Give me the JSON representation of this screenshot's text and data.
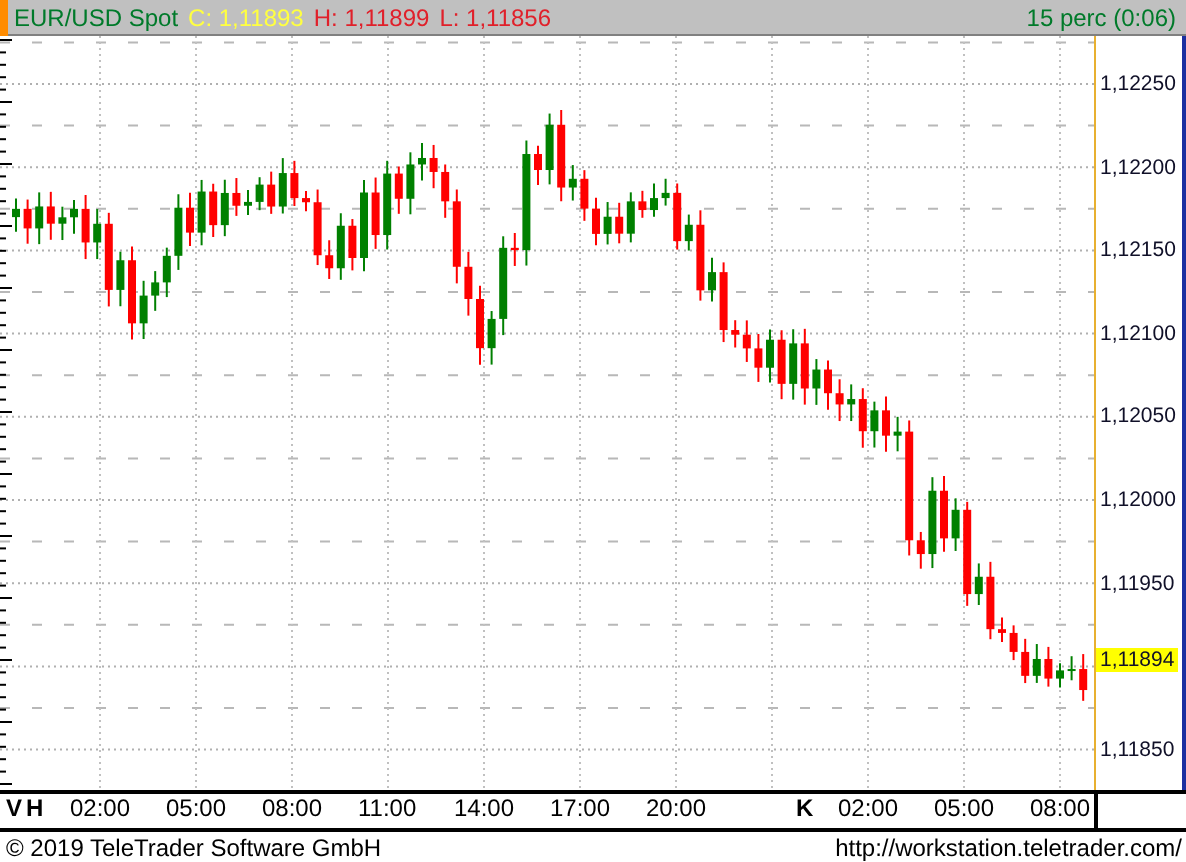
{
  "header": {
    "symbol": "EUR/USD Spot",
    "close": "C: 1,11893",
    "high": "H: 1,11899",
    "low": "L: 1,11856",
    "interval": "15 perc (0:06)"
  },
  "y_axis": {
    "labels": [
      {
        "text": "1,12250",
        "kind": "tick"
      },
      {
        "text": "1,12200",
        "kind": "tick"
      },
      {
        "text": "1,12150",
        "kind": "tick"
      },
      {
        "text": "1,12100",
        "kind": "tick"
      },
      {
        "text": "1,12050",
        "kind": "tick"
      },
      {
        "text": "1,12000",
        "kind": "tick"
      },
      {
        "text": "1,11950",
        "kind": "tick"
      },
      {
        "text": "1,11894",
        "kind": "current"
      },
      {
        "text": "1,11850",
        "kind": "tick"
      }
    ]
  },
  "x_axis": {
    "labels": [
      {
        "text": "V",
        "kind": "day"
      },
      {
        "text": "H",
        "kind": "day"
      },
      {
        "text": "02:00",
        "kind": "time"
      },
      {
        "text": "05:00",
        "kind": "time"
      },
      {
        "text": "08:00",
        "kind": "time"
      },
      {
        "text": "11:00",
        "kind": "time"
      },
      {
        "text": "14:00",
        "kind": "time"
      },
      {
        "text": "17:00",
        "kind": "time"
      },
      {
        "text": "20:00",
        "kind": "time"
      },
      {
        "text": "K",
        "kind": "day"
      },
      {
        "text": "02:00",
        "kind": "time"
      },
      {
        "text": "05:00",
        "kind": "time"
      },
      {
        "text": "08:00",
        "kind": "time"
      }
    ]
  },
  "footer": {
    "copyright": "© 2019 TeleTrader Software GmbH",
    "url": "http://workstation.teletrader.com/"
  }
}
